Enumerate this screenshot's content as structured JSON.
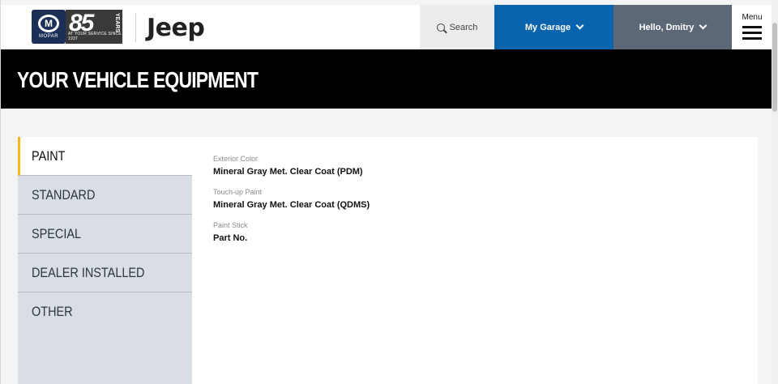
{
  "header": {
    "mopar_logo_text": "MOPAR",
    "years_badge": {
      "number": "85",
      "word": "YEARS",
      "tagline": "AT YOUR SERVICE SINCE 1937"
    },
    "brand": "Jeep",
    "search_label": "Search",
    "garage_label": "My Garage",
    "user_label": "Hello, Dmitry",
    "menu_label": "Menu",
    "colors": {
      "garage_bg": "#0a63ad",
      "user_bg": "#5c6875",
      "banner_bg": "#000000",
      "active_accent": "#f4b81f"
    },
    "icons": {
      "search": "search-icon",
      "dropdown": "chevron-down-icon",
      "menu": "hamburger-icon"
    }
  },
  "banner": {
    "title": "YOUR VEHICLE EQUIPMENT"
  },
  "sidebar": {
    "items": [
      {
        "label": "PAINT",
        "active": true
      },
      {
        "label": "STANDARD",
        "active": false
      },
      {
        "label": "SPECIAL",
        "active": false
      },
      {
        "label": "DEALER INSTALLED",
        "active": false
      },
      {
        "label": "OTHER",
        "active": false
      }
    ]
  },
  "details": {
    "fields": [
      {
        "label": "Exterior Color",
        "value": "Mineral Gray Met. Clear Coat (PDM)"
      },
      {
        "label": "Touch-up Paint",
        "value": "Mineral Gray Met. Clear Coat (QDMS)"
      },
      {
        "label": "Paint Stick",
        "value": "Part No."
      }
    ]
  }
}
